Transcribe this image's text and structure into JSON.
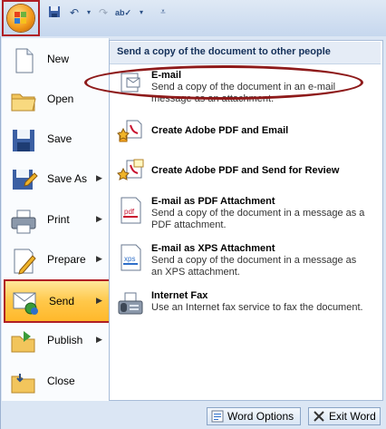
{
  "quick_access": {
    "icons": [
      "save-icon",
      "undo-icon",
      "redo-icon",
      "spelling-icon",
      "customize-icon"
    ]
  },
  "left_menu": {
    "items": [
      {
        "label": "New",
        "arrow": false
      },
      {
        "label": "Open",
        "arrow": false
      },
      {
        "label": "Save",
        "arrow": false
      },
      {
        "label": "Save As",
        "arrow": true
      },
      {
        "label": "Print",
        "arrow": true
      },
      {
        "label": "Prepare",
        "arrow": true
      },
      {
        "label": "Send",
        "arrow": true,
        "selected": true
      },
      {
        "label": "Publish",
        "arrow": true
      },
      {
        "label": "Close",
        "arrow": false
      }
    ]
  },
  "send_panel": {
    "title": "Send a copy of the document to other people",
    "items": [
      {
        "title": "E-mail",
        "desc": "Send a copy of the document in an e-mail message as an attachment."
      },
      {
        "title": "Create Adobe PDF and Email",
        "desc": ""
      },
      {
        "title": "Create Adobe PDF and Send for Review",
        "desc": ""
      },
      {
        "title": "E-mail as PDF Attachment",
        "desc": "Send a copy of the document in a message as a PDF attachment."
      },
      {
        "title": "E-mail as XPS Attachment",
        "desc": "Send a copy of the document in a message as an XPS attachment."
      },
      {
        "title": "Internet Fax",
        "desc": "Use an Internet fax service to fax the document."
      }
    ]
  },
  "footer": {
    "word_options": "Word Options",
    "exit_word": "Exit Word"
  },
  "colors": {
    "highlight_border": "#b01e24",
    "selected_bg": "#ffc84a",
    "menu_bg": "#dbe6f4"
  }
}
